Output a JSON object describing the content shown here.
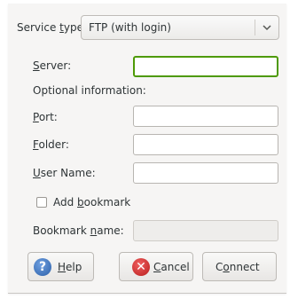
{
  "service": {
    "label_pre": "Service ",
    "label_u": "t",
    "label_post": "ype:",
    "selected": "FTP (with login)"
  },
  "fields": {
    "server": {
      "label_u": "S",
      "label_rest": "erver:"
    },
    "optional": "Optional information:",
    "port": {
      "label_u": "P",
      "label_rest": "ort:"
    },
    "folder": {
      "label_u": "F",
      "label_rest": "older:"
    },
    "username": {
      "label_u": "U",
      "label_rest": "ser Name:"
    }
  },
  "bookmark": {
    "check_pre": "Add ",
    "check_u": "b",
    "check_post": "ookmark",
    "name_pre": "Bookmark ",
    "name_u": "n",
    "name_post": "ame:"
  },
  "buttons": {
    "help_u": "H",
    "help_rest": "elp",
    "cancel_u": "C",
    "cancel_rest": "ancel",
    "connect_pre": "C",
    "connect_u": "o",
    "connect_post": "nnect"
  }
}
